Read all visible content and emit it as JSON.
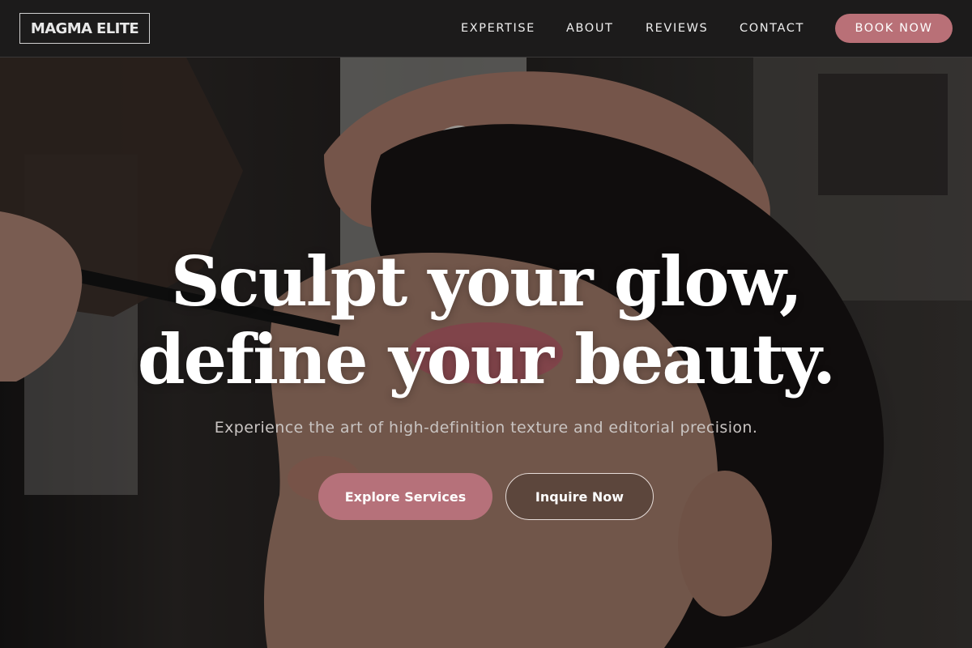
{
  "brand": {
    "logo_text": "MAGMA ELITE"
  },
  "nav": {
    "links": [
      {
        "label": "EXPERTISE"
      },
      {
        "label": "ABOUT"
      },
      {
        "label": "REVIEWS"
      },
      {
        "label": "CONTACT"
      }
    ],
    "cta_label": "BOOK NOW"
  },
  "hero": {
    "headline_line1": "Sculpt your glow,",
    "headline_line2": "define your beauty.",
    "subtext": "Experience the art of high-definition texture and editorial precision.",
    "primary_button": "Explore Services",
    "secondary_button": "Inquire Now",
    "image_subject": "makeup-artist-applying-eye-makeup-photo"
  },
  "colors": {
    "nav_background": "#1c1b1b",
    "accent": "#b97077",
    "text_light": "#ffffff"
  }
}
